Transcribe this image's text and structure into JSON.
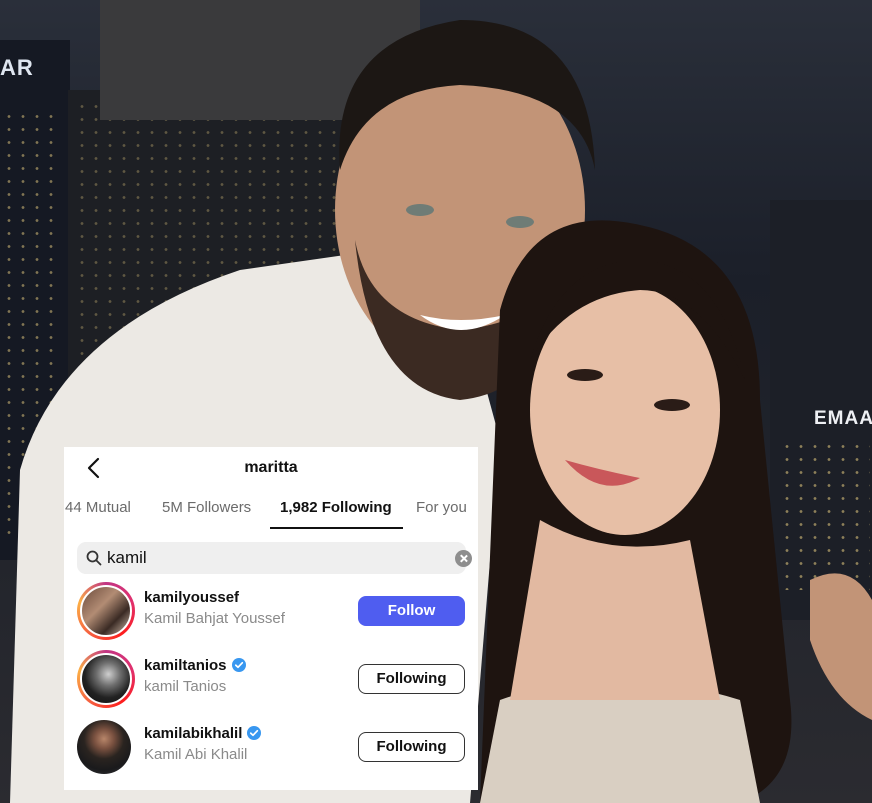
{
  "colors": {
    "follow_button": "#4f5df0",
    "verified_badge": "#3897f0",
    "annotation_arrow": "#c0392b"
  },
  "background": {
    "sign_left": "AR",
    "sign_right": "EMAA"
  },
  "header": {
    "title": "maritta",
    "back_icon": "chevron-left-icon"
  },
  "tabs": [
    {
      "label": "44 Mutual",
      "active": false
    },
    {
      "label": "5M Followers",
      "active": false
    },
    {
      "label": "1,982 Following",
      "active": true
    },
    {
      "label": "For you",
      "active": false
    }
  ],
  "search": {
    "value": "kamil",
    "search_icon": "search-icon",
    "clear_icon": "clear-icon"
  },
  "results": [
    {
      "username": "kamilyoussef",
      "full_name": "Kamil Bahjat Youssef",
      "verified": false,
      "button": "Follow",
      "story_ring": true
    },
    {
      "username": "kamiltanios",
      "full_name": "kamil Tanios",
      "verified": true,
      "button": "Following",
      "story_ring": true
    },
    {
      "username": "kamilabikhalil",
      "full_name": "Kamil Abi Khalil",
      "verified": true,
      "button": "Following",
      "story_ring": false
    }
  ]
}
